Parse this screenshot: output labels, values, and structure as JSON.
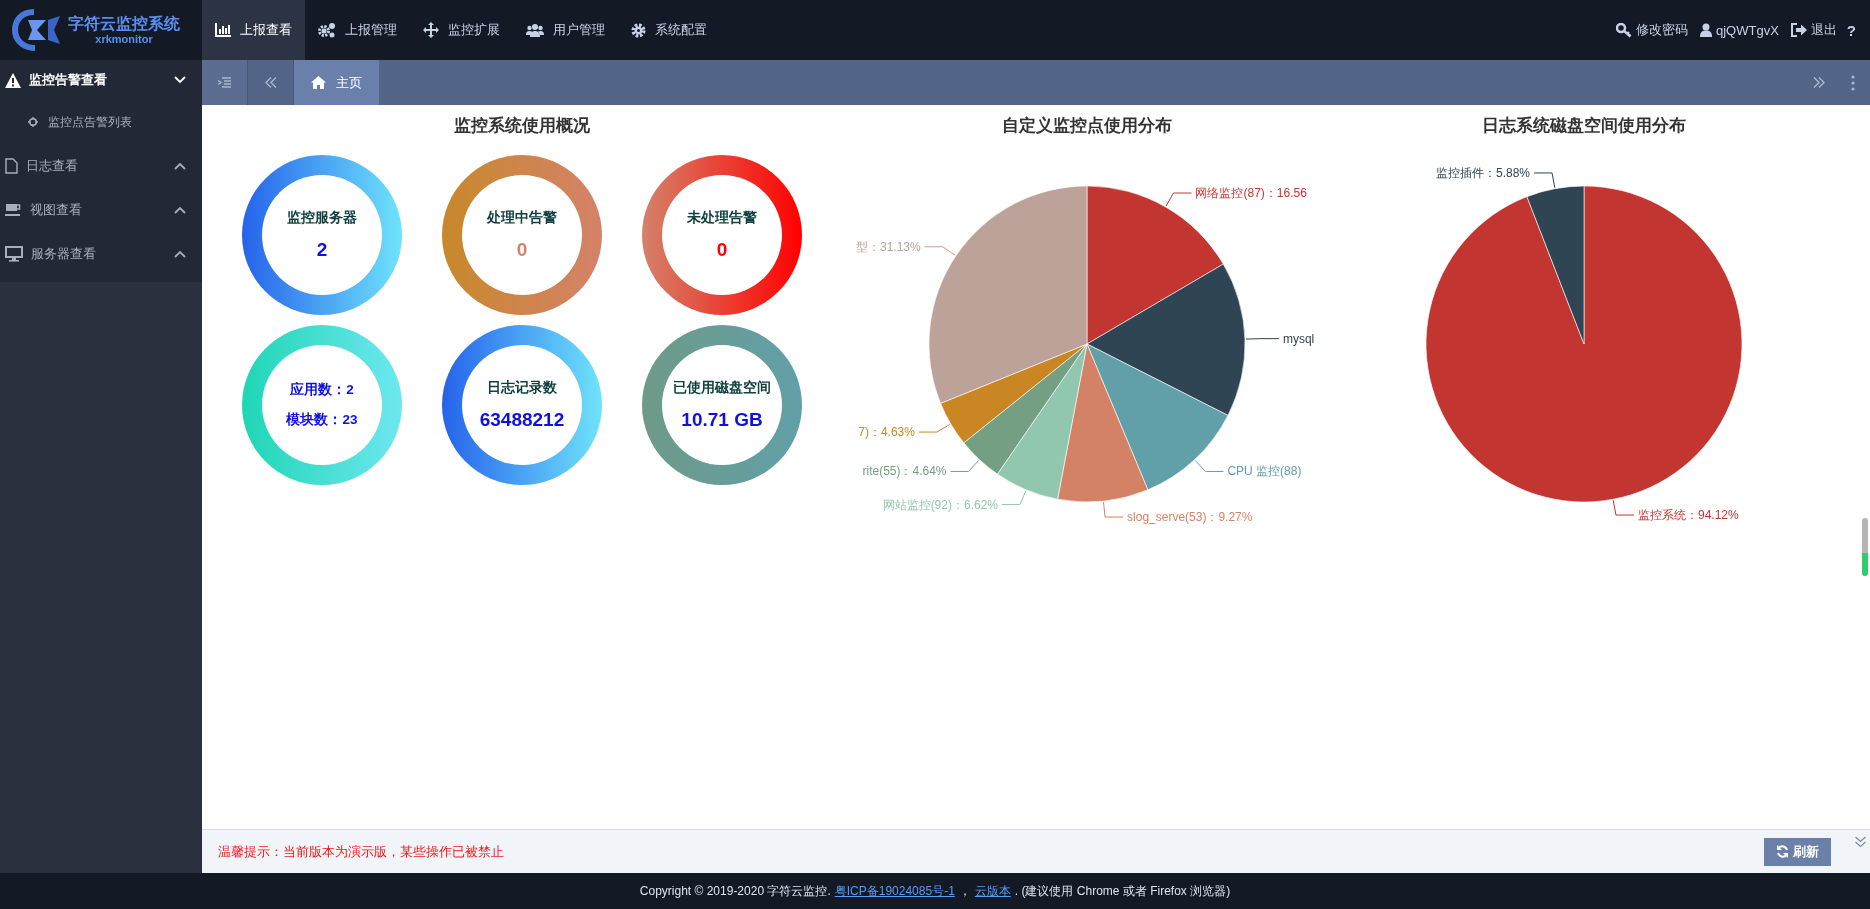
{
  "brand": {
    "name": "字符云监控系统",
    "sub": "xrkmonitor"
  },
  "nav": [
    {
      "label": "上报查看",
      "selected": true
    },
    {
      "label": "上报管理",
      "selected": false
    },
    {
      "label": "监控扩展",
      "selected": false
    },
    {
      "label": "用户管理",
      "selected": false
    },
    {
      "label": "系统配置",
      "selected": false
    }
  ],
  "user_menu": [
    {
      "label": "修改密码"
    },
    {
      "label": "qjQWTgvX"
    },
    {
      "label": "退出"
    },
    {
      "label": "?"
    }
  ],
  "sidebar": {
    "items": [
      {
        "label": "监控告警查看",
        "expanded": true,
        "children": [
          {
            "label": "监控点告警列表"
          }
        ]
      },
      {
        "label": "日志查看",
        "expanded": false
      },
      {
        "label": "视图查看",
        "expanded": false
      },
      {
        "label": "服务器查看",
        "expanded": false
      }
    ]
  },
  "tabs": [
    {
      "label": "主页",
      "selected": true
    }
  ],
  "overview": {
    "title": "监控系统使用概况",
    "rings": [
      {
        "kind": "stat",
        "label": "监控服务器",
        "value": "2",
        "color": "#2563eb"
      },
      {
        "kind": "stat",
        "label": "处理中告警",
        "value": "0",
        "color": "#c8882a"
      },
      {
        "kind": "stat",
        "label": "未处理告警",
        "value": "0",
        "color": "#d4826a"
      },
      {
        "kind": "lines",
        "lines": [
          "应用数：2",
          "模块数：23"
        ],
        "color": "#1fd6b5"
      },
      {
        "kind": "stat",
        "label": "日志记录数",
        "value": "63488212",
        "color": "#2563eb"
      },
      {
        "kind": "stat",
        "label": "已使用磁盘空间",
        "value": "10.71 GB",
        "color": "#6e9a88"
      }
    ]
  },
  "charts": [
    {
      "title": "自定义监控点使用分布",
      "chart_data": {
        "type": "pie",
        "categories": [
          "网络监控(87)：16.56",
          "mysql",
          "CPU 监控(88)",
          "slog_serve(53)：9.27%",
          "网站监控(92)：6.62%",
          "rite(55)：4.64%",
          "7)：4.63%",
          "型：31.13%"
        ],
        "values": [
          16.56,
          15.9,
          11.25,
          9.27,
          6.62,
          4.64,
          4.63,
          31.13
        ]
      }
    },
    {
      "title": "日志系统磁盘空间使用分布",
      "chart_data": {
        "type": "pie",
        "categories": [
          "监控系统：94.12%",
          "监控插件：5.88%"
        ],
        "values": [
          94.12,
          5.88
        ]
      }
    }
  ],
  "notice": "温馨提示：当前版本为演示版，某些操作已被禁止",
  "refresh_button": "刷新",
  "footer": [
    {
      "kind": "text",
      "text": "Copyright © 2019-2020 字符云监控."
    },
    {
      "kind": "link",
      "text": "粤ICP备19024085号-1"
    },
    {
      "kind": "text",
      "text": "，"
    },
    {
      "kind": "link",
      "text": "云版本"
    },
    {
      "kind": "text",
      "text": ". (建议使用 Chrome 或者 Firefox 浏览器)"
    }
  ]
}
